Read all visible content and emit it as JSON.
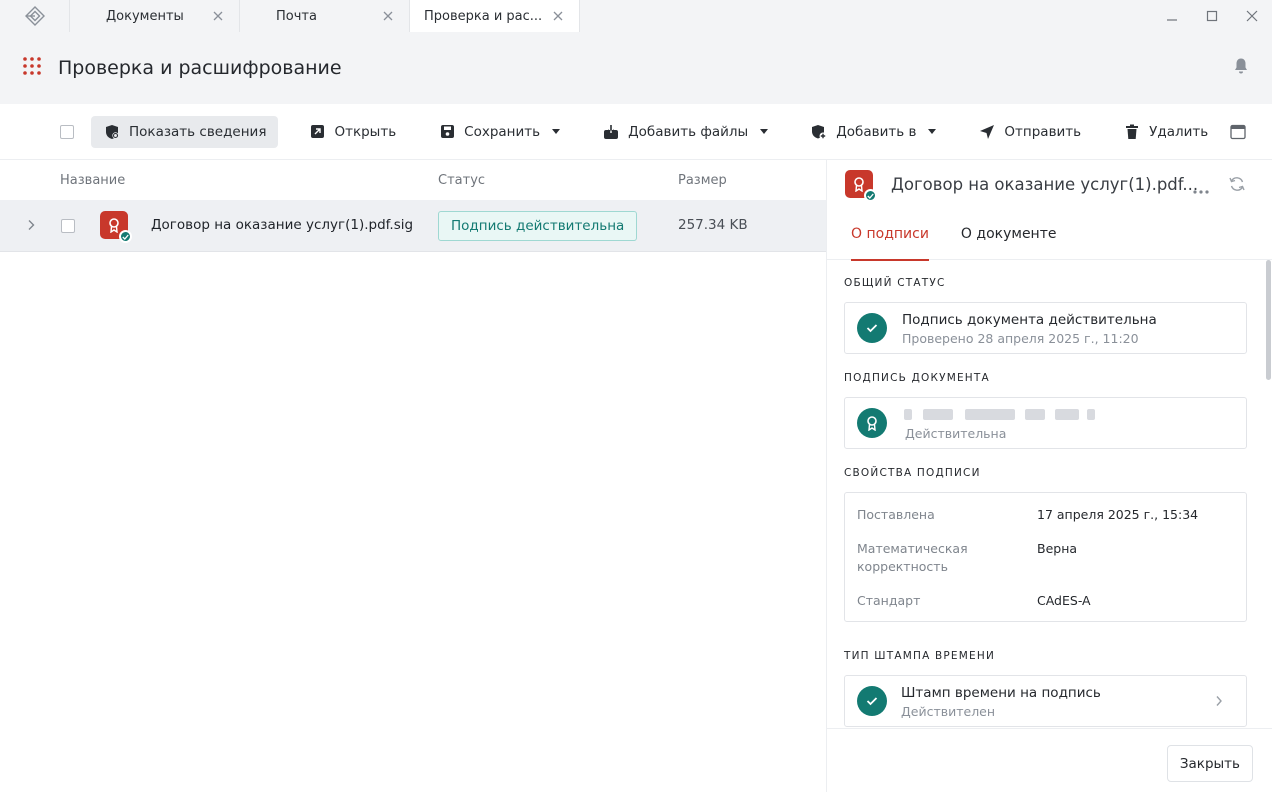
{
  "tabs": [
    {
      "label": "Документы"
    },
    {
      "label": "Почта"
    },
    {
      "label": "Проверка и рас..."
    }
  ],
  "header": {
    "title": "Проверка и расшифрование"
  },
  "toolbar": {
    "show_info": "Показать сведения",
    "open": "Открыть",
    "save": "Сохранить",
    "add_files": "Добавить файлы",
    "add_to": "Добавить в",
    "send": "Отправить",
    "delete": "Удалить"
  },
  "list": {
    "columns": {
      "name": "Название",
      "status": "Статус",
      "size": "Размер"
    },
    "rows": [
      {
        "name": "Договор на оказание услуг(1).pdf.sig",
        "status": "Подпись действительна",
        "size": "257.34 KB"
      }
    ]
  },
  "panel": {
    "title": "Договор на оказание услуг(1).pdf...",
    "tabs": {
      "signature": "О подписи",
      "document": "О документе"
    },
    "overall_status": {
      "label": "Общий статус",
      "title": "Подпись документа действительна",
      "subtitle": "Проверено 28 апреля 2025 г., 11:20"
    },
    "doc_signature": {
      "label": "Подпись документа",
      "status": "Действительна"
    },
    "properties": {
      "label": "Свойства подписи",
      "items": [
        {
          "key": "Поставлена",
          "value": "17 апреля 2025 г., 15:34"
        },
        {
          "key": "Математическая корректность",
          "value": "Верна"
        },
        {
          "key": "Стандарт",
          "value": "CAdES-A"
        }
      ]
    },
    "timestamp": {
      "label": "Тип штампа времени",
      "title": "Штамп времени на подпись",
      "subtitle": "Действителен"
    },
    "close_label": "Закрыть"
  },
  "colors": {
    "accent": "#c8382b",
    "success": "#137a72",
    "header_bg": "#f3f4f6"
  }
}
